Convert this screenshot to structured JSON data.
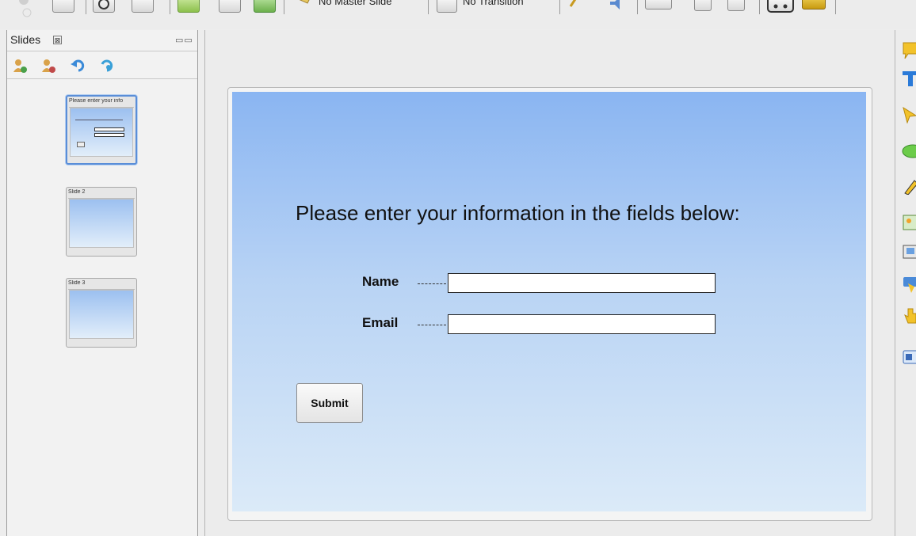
{
  "toolbar": {
    "master_label": "No Master Slide",
    "transition_label": "No Transition"
  },
  "slides_panel": {
    "title": "Slides",
    "close_glyph": "⊠",
    "minmax_glyph": "▭▭",
    "thumbnails": [
      {
        "title": "Please enter your info",
        "selected": true
      },
      {
        "title": "Slide 2",
        "selected": false
      },
      {
        "title": "Slide 3",
        "selected": false
      }
    ]
  },
  "slide": {
    "heading": "Please enter your information in the fields below:",
    "fields": [
      {
        "label": "Name",
        "value": ""
      },
      {
        "label": "Email",
        "value": ""
      }
    ],
    "submit_label": "Submit"
  },
  "colors": {
    "selection_border": "#5a8ed8",
    "slide_gradient_top": "#8ab5f2",
    "slide_gradient_bottom": "#dbeaf8"
  },
  "right_tools": [
    "speech-bubble-icon",
    "text-tool-icon",
    "select-cursor-icon",
    "shape-icon",
    "pen-tool-icon",
    "image-icon",
    "screenshot-icon",
    "button-widget-icon",
    "click-hand-icon",
    "input-field-icon"
  ]
}
